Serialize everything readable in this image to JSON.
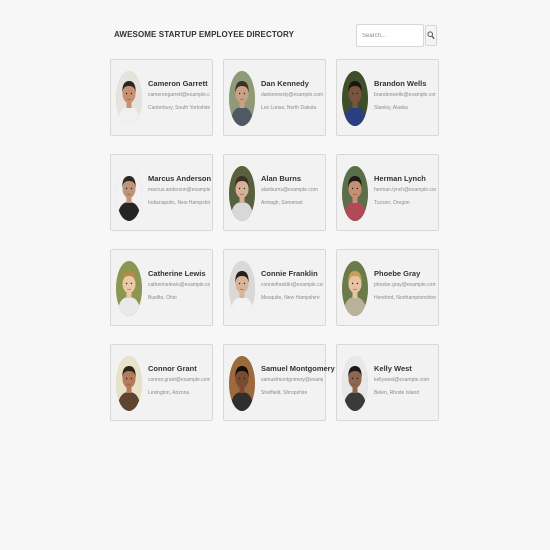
{
  "header": {
    "title": "AWESOME STARTUP EMPLOYEE DIRECTORY",
    "search_placeholder": "Search...",
    "search_button_icon": "magnifier-icon"
  },
  "employees": [
    {
      "name": "Cameron Garrett",
      "email": "camerongarrett@example.com",
      "location": "Canterbury, South Yorkshire",
      "colors": {
        "bg": "#e6e2dc",
        "skin": "#c69173",
        "hair": "#2b2520",
        "shirt": "#f0f0f0"
      }
    },
    {
      "name": "Dan Kennedy",
      "email": "dankennedy@example.com",
      "location": "Los Lunas, North Dakota",
      "colors": {
        "bg": "#8f9a76",
        "skin": "#c9a184",
        "hair": "#3a332c",
        "shirt": "#4e5a63"
      }
    },
    {
      "name": "Brandon Wells",
      "email": "brandonwells@example.com",
      "location": "Stanley, Alaska",
      "colors": {
        "bg": "#3f4f2a",
        "skin": "#7a5440",
        "hair": "#1b1512",
        "shirt": "#2a3e80"
      }
    },
    {
      "name": "Marcus Anderson",
      "email": "marcus.anderson@example.com",
      "location": "Indianapolis, New Hampshire",
      "colors": {
        "bg": "#f2f2f2",
        "skin": "#c09478",
        "hair": "#2e2824",
        "shirt": "#252525"
      }
    },
    {
      "name": "Alan Burns",
      "email": "alanburns@example.com",
      "location": "Armagh, Somerset",
      "colors": {
        "bg": "#58613d",
        "skin": "#d7b095",
        "hair": "#3b2e26",
        "shirt": "#d8d8d8"
      }
    },
    {
      "name": "Herman Lynch",
      "email": "herman.lynch@example.com",
      "location": "Tucson, Oregon",
      "colors": {
        "bg": "#5b6e4a",
        "skin": "#c98f74",
        "hair": "#1f1a16",
        "shirt": "#b04a56"
      }
    },
    {
      "name": "Catherine Lewis",
      "email": "catherinelewis@example.com",
      "location": "Buellto, Ohio",
      "colors": {
        "bg": "#8c9650",
        "skin": "#eac9a8",
        "hair": "#b58a49",
        "shirt": "#e9e9e9"
      }
    },
    {
      "name": "Connie Franklin",
      "email": "conniefranklin@example.com",
      "location": "Mesquite, New Hampshire",
      "colors": {
        "bg": "#d9d9d9",
        "skin": "#d8b49a",
        "hair": "#2a1f1a",
        "shirt": "#f2f2f2"
      }
    },
    {
      "name": "Phoebe Gray",
      "email": "phoebe.gray@example.com",
      "location": "Hereford, Northamptonshire",
      "colors": {
        "bg": "#6b7a4a",
        "skin": "#e8c4a4",
        "hair": "#c99d5c",
        "shirt": "#b9b29a"
      }
    },
    {
      "name": "Connor Grant",
      "email": "connor.grant@example.com",
      "location": "Lexington, Arizona",
      "colors": {
        "bg": "#e7e3c9",
        "skin": "#b57a58",
        "hair": "#2d231b",
        "shirt": "#5f4430"
      }
    },
    {
      "name": "Samuel Montgomery",
      "email": "samuelmontgomery@example.com",
      "location": "Sheffield, Shropshire",
      "colors": {
        "bg": "#9c6a3d",
        "skin": "#7a4b31",
        "hair": "#150f0c",
        "shirt": "#2f2f2f"
      }
    },
    {
      "name": "Kelly West",
      "email": "kellywest@example.com",
      "location": "Belen, Rhode Island",
      "colors": {
        "bg": "#e8e8e8",
        "skin": "#8f6550",
        "hair": "#1e1814",
        "shirt": "#3a3a3a"
      }
    }
  ]
}
